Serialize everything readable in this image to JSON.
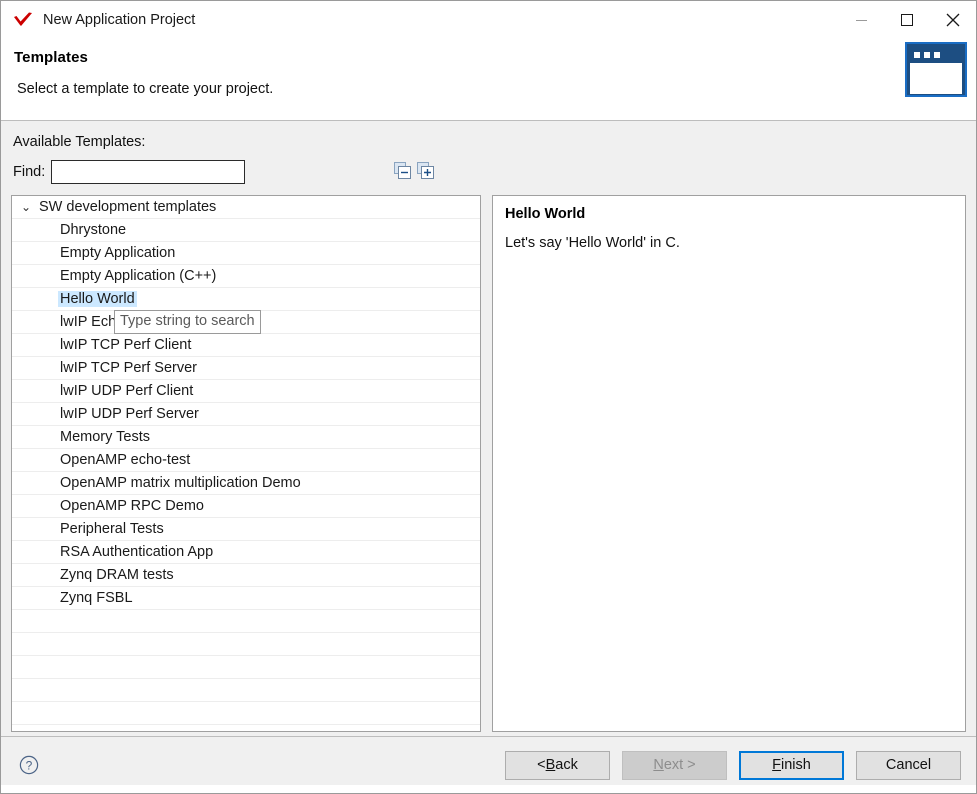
{
  "window": {
    "title": "New Application Project",
    "app_icon": "red-check-icon",
    "minimize_label": "Minimize",
    "maximize_label": "Maximize",
    "close_label": "Close"
  },
  "header": {
    "title": "Templates",
    "subtitle": "Select a template to create your project.",
    "banner_icon": "wizard-window-icon"
  },
  "content": {
    "available_label": "Available Templates:",
    "find_label": "Find:",
    "find_value": "",
    "find_placeholder": "",
    "tooltip": "Type string to search",
    "collapse_all_label": "Collapse All",
    "expand_all_label": "Expand All"
  },
  "tree": {
    "group_label": "SW development templates",
    "caret": "⌄",
    "selected": "Hello World",
    "items": [
      "Dhrystone",
      "Empty Application",
      "Empty Application (C++)",
      "Hello World",
      "lwIP Echo Server",
      "lwIP TCP Perf Client",
      "lwIP TCP Perf Server",
      "lwIP UDP Perf Client",
      "lwIP UDP Perf Server",
      "Memory Tests",
      "OpenAMP echo-test",
      "OpenAMP matrix multiplication Demo",
      "OpenAMP RPC Demo",
      "Peripheral Tests",
      "RSA Authentication App",
      "Zynq DRAM tests",
      "Zynq FSBL"
    ],
    "empty_rows": 5
  },
  "detail": {
    "title": "Hello World",
    "description": "Let's say 'Hello World' in C."
  },
  "footer": {
    "help_label": "?",
    "buttons": [
      {
        "id": "back",
        "prefix": "< ",
        "mnemonic": "B",
        "suffix": "ack",
        "state": "enabled"
      },
      {
        "id": "next",
        "prefix": "",
        "mnemonic": "N",
        "suffix": "ext >",
        "state": "disabled"
      },
      {
        "id": "finish",
        "prefix": "",
        "mnemonic": "F",
        "suffix": "inish",
        "state": "default"
      },
      {
        "id": "cancel",
        "prefix": "",
        "mnemonic": "",
        "suffix": "Cancel",
        "state": "enabled"
      }
    ]
  },
  "colors": {
    "accent": "#0078d7",
    "selection": "#cce8ff",
    "banner": "#1d4e82",
    "title_icon": "#cc0000",
    "dialog_bg": "#f0f0f0"
  }
}
